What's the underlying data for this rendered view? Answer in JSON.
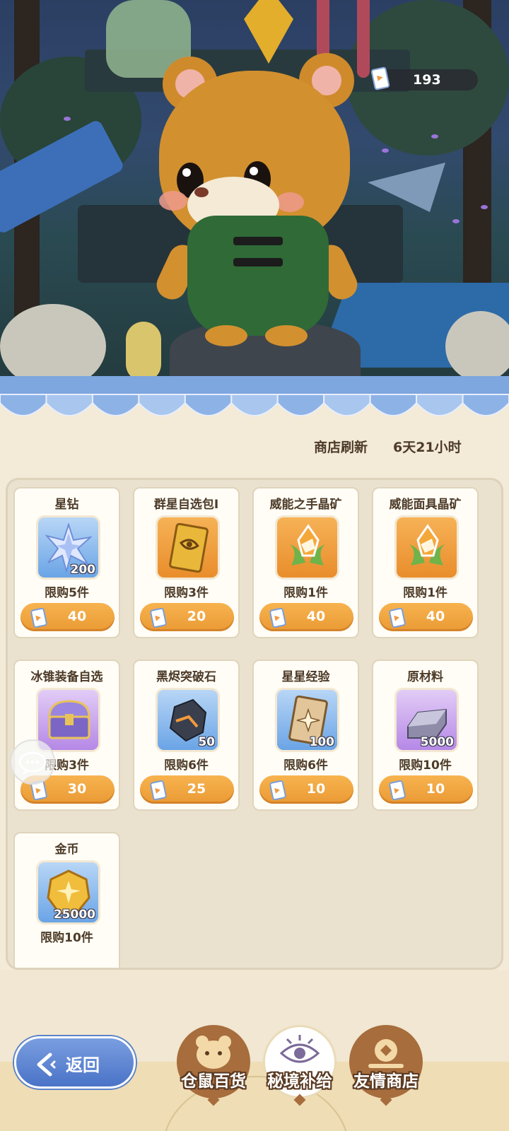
{
  "currency": {
    "value": "193",
    "icon": "ticket-icon"
  },
  "shop": {
    "refresh_label": "商店刷新",
    "refresh_time": "6天21小时"
  },
  "items": [
    {
      "name": "星钻",
      "qty": "200",
      "limit": "限购5件",
      "price": "40",
      "bg": "blue",
      "icon": "star-diamond-icon"
    },
    {
      "name": "群星自选包Ⅰ",
      "qty": "",
      "limit": "限购3件",
      "price": "20",
      "bg": "orange",
      "icon": "card-pack-icon"
    },
    {
      "name": "威能之手晶矿",
      "qty": "",
      "limit": "限购1件",
      "price": "40",
      "bg": "orange",
      "icon": "crystal-ore-icon"
    },
    {
      "name": "威能面具晶矿",
      "qty": "",
      "limit": "限购1件",
      "price": "40",
      "bg": "orange",
      "icon": "crystal-ore-icon"
    },
    {
      "name": "冰锥装备自选",
      "qty": "",
      "limit": "限购3件",
      "price": "30",
      "bg": "purple",
      "icon": "treasure-chest-icon"
    },
    {
      "name": "黑烬突破石",
      "qty": "50",
      "limit": "限购6件",
      "price": "25",
      "bg": "blue",
      "icon": "breakthrough-stone-icon"
    },
    {
      "name": "星星经验",
      "qty": "100",
      "limit": "限购6件",
      "price": "10",
      "bg": "blue",
      "icon": "exp-card-icon"
    },
    {
      "name": "原材料",
      "qty": "5000",
      "limit": "限购10件",
      "price": "10",
      "bg": "purple",
      "icon": "ingot-icon"
    },
    {
      "name": "金币",
      "qty": "25000",
      "limit": "限购10件",
      "price": "",
      "bg": "blue",
      "icon": "gold-coin-icon"
    }
  ],
  "nav": {
    "back_label": "返回",
    "tabs": [
      "仓鼠百货",
      "秘境补给",
      "友情商店"
    ],
    "active_tab": "秘境补给"
  },
  "colors": {
    "accent_orange": "#ea9a34",
    "back_blue": "#4a73c7",
    "panel_bg": "#eae2ce"
  }
}
